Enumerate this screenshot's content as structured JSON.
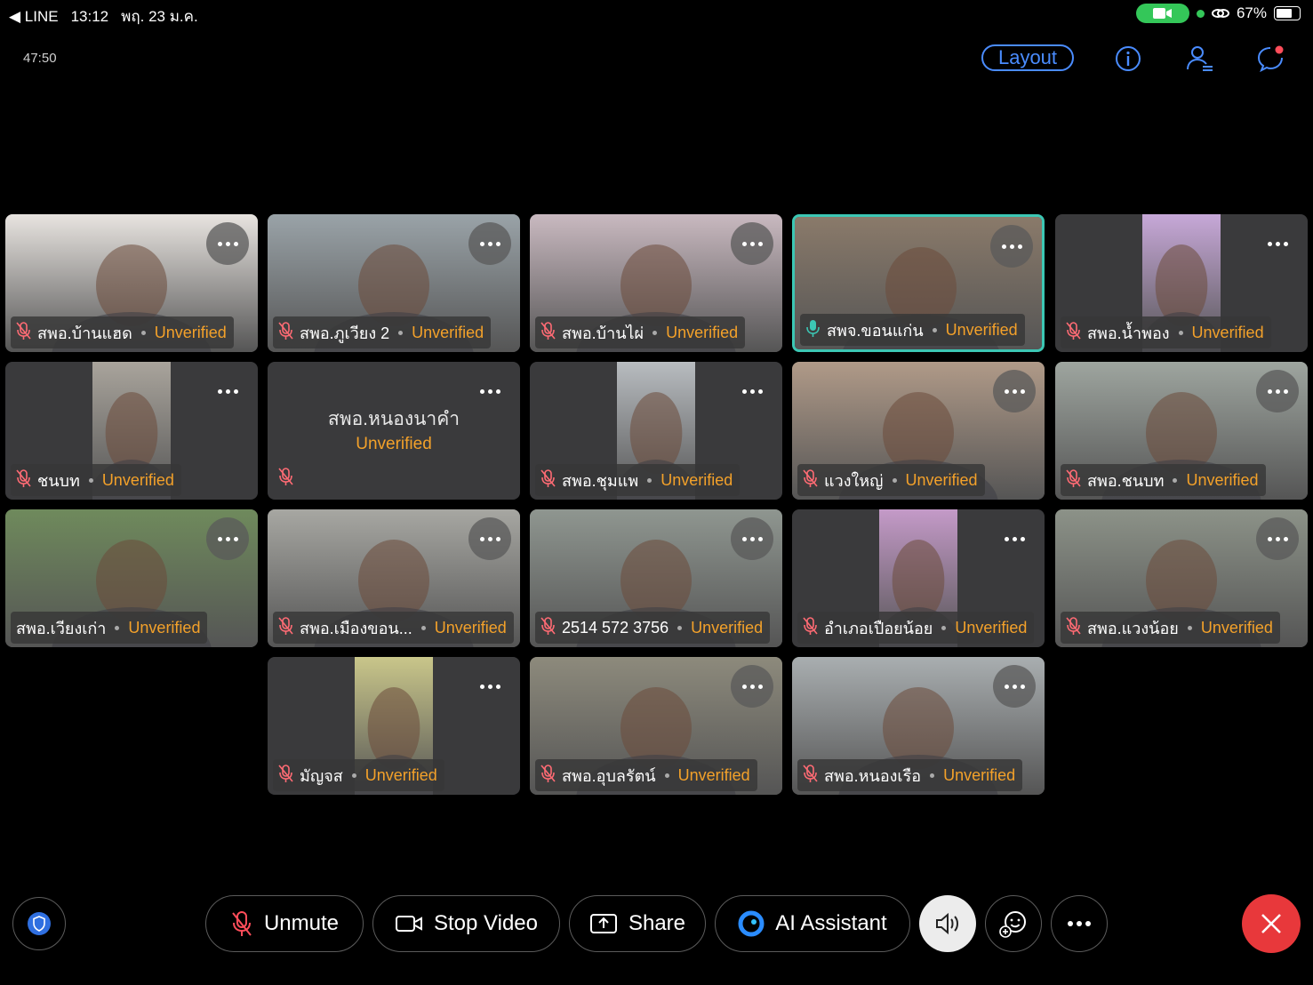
{
  "status_bar": {
    "back_app": "◀ LINE",
    "time": "13:12",
    "date": "พฤ. 23 ม.ค.",
    "battery": "67%",
    "battery_level": 0.67
  },
  "meeting": {
    "elapsed": "47:50",
    "layout_label": "Layout"
  },
  "participants": [
    {
      "name": "สพอ.บ้านแฮด",
      "status": "Unverified",
      "mic": "muted",
      "video": true,
      "bg": "#e8e4e0"
    },
    {
      "name": "สพอ.ภูเวียง 2",
      "status": "Unverified",
      "mic": "muted",
      "video": true,
      "bg": "#9aa3a8"
    },
    {
      "name": "สพอ.บ้านไผ่",
      "status": "Unverified",
      "mic": "muted",
      "video": true,
      "bg": "#c9b9c0"
    },
    {
      "name": "สพจ.ขอนแก่น",
      "status": "Unverified",
      "mic": "on",
      "video": true,
      "active": true,
      "bg": "#8a7a6a"
    },
    {
      "name": "สพอ.น้ำพอง",
      "status": "Unverified",
      "mic": "muted",
      "video": true,
      "narrow": true,
      "bg": "#c7a8d8"
    },
    {
      "name": "ชนบท",
      "status": "Unverified",
      "mic": "muted",
      "video": true,
      "narrow": true,
      "bg": "#a9a49c"
    },
    {
      "name": "สพอ.หนองนาคำ",
      "status": "Unverified",
      "mic": "muted",
      "video": false
    },
    {
      "name": "สพอ.ชุมแพ",
      "status": "Unverified",
      "mic": "muted",
      "video": true,
      "narrow": true,
      "bg": "#b8bcc0"
    },
    {
      "name": "แวงใหญ่",
      "status": "Unverified",
      "mic": "muted",
      "video": true,
      "bg": "#b09a88"
    },
    {
      "name": "สพอ.ชนบท",
      "status": "Unverified",
      "mic": "muted",
      "video": true,
      "bg": "#9ea59f"
    },
    {
      "name": "สพอ.เวียงเก่า",
      "status": "Unverified",
      "mic": "none",
      "video": true,
      "bg": "#6f8a5c"
    },
    {
      "name": "สพอ.เมืองขอน...",
      "status": "Unverified",
      "mic": "muted",
      "video": true,
      "bg": "#a7a7a2"
    },
    {
      "name": "2514 572 3756",
      "status": "Unverified",
      "mic": "muted",
      "video": true,
      "bg": "#8f9690"
    },
    {
      "name": "อำเภอเปือยน้อย",
      "status": "Unverified",
      "mic": "muted",
      "video": true,
      "narrow": true,
      "bg": "#c49ac8"
    },
    {
      "name": "สพอ.แวงน้อย",
      "status": "Unverified",
      "mic": "muted",
      "video": true,
      "bg": "#8c9288"
    },
    {
      "name": "มัญจส",
      "status": "Unverified",
      "mic": "muted",
      "video": true,
      "narrow": true,
      "bg": "#c9c68a"
    },
    {
      "name": "สพอ.อุบลรัตน์",
      "status": "Unverified",
      "mic": "muted",
      "video": true,
      "bg": "#8d8a7c"
    },
    {
      "name": "สพอ.หนองเรือ",
      "status": "Unverified",
      "mic": "muted",
      "video": true,
      "bg": "#a9aeb0"
    }
  ],
  "toolbar": {
    "unmute": "Unmute",
    "stop_video": "Stop Video",
    "share": "Share",
    "ai_assistant": "AI Assistant"
  },
  "colors": {
    "accent_blue": "#4a8cff",
    "unverified_orange": "#f3a12a",
    "active_speaker": "#3cc7b4",
    "end_red": "#e8383b"
  }
}
